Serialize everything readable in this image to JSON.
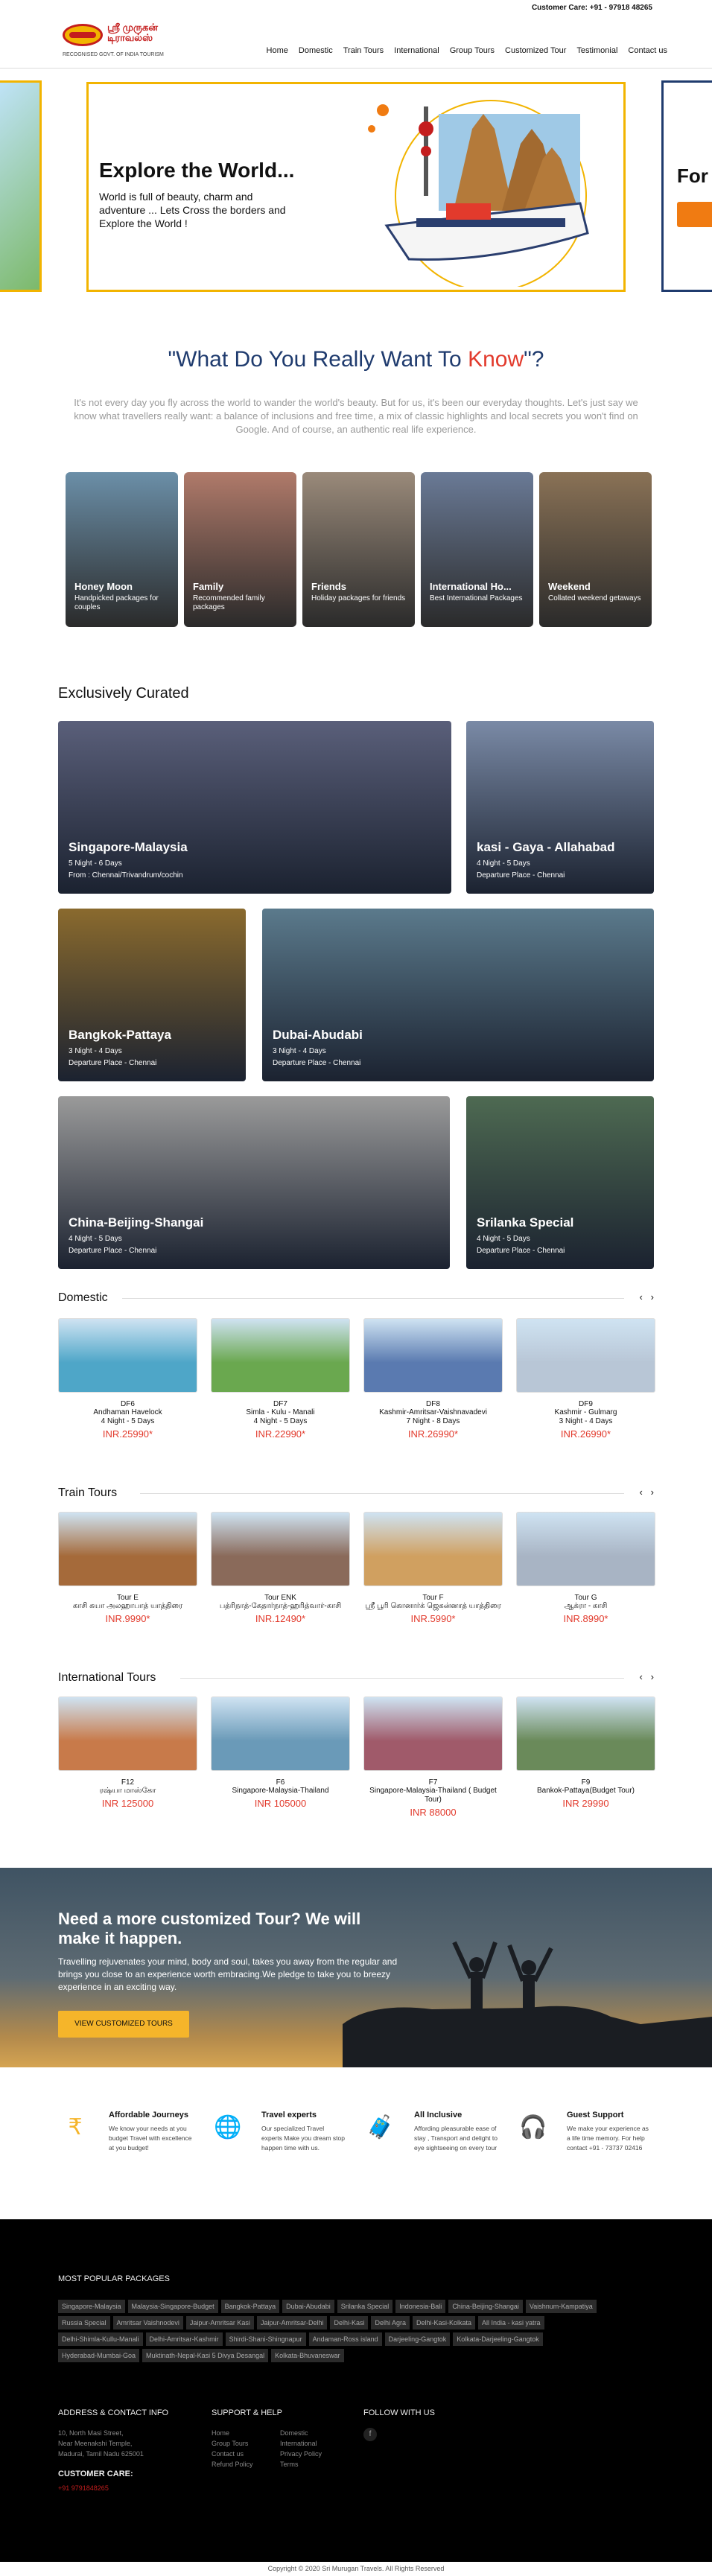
{
  "topbar": {
    "customer_care": "Customer Care: +91 - 97918 48265"
  },
  "logo": {
    "title": "ஸ்ரீ முருகன் டிராவல்ஸ்",
    "sub": "RECOGNISED GOVT. OF INDIA TOURISM"
  },
  "nav": [
    "Home",
    "Domestic",
    "Train Tours",
    "International",
    "Group Tours",
    "Customized Tour",
    "Testimonial",
    "Contact us"
  ],
  "hero": {
    "title": "Explore the World...",
    "text": "World is full of beauty, charm and adventure ... Lets Cross the borders and Explore the World !",
    "side_text": "For"
  },
  "section": {
    "title_a": "\"What Do You Really Want To ",
    "title_b": "Know",
    "title_c": "\"?",
    "intro": "It's not every day you fly across the world to wander the world's beauty. But for us, it's been our everyday thoughts. Let's just say we know what travellers really want: a balance of inclusions and free time, a mix of classic highlights and local secrets you won't find on Google. And of course, an authentic real life experience."
  },
  "categories": [
    {
      "title": "Honey Moon",
      "desc": "Handpicked packages for couples",
      "color": "#6b8fa8"
    },
    {
      "title": "Family",
      "desc": "Recommended family packages",
      "color": "#b07a6a"
    },
    {
      "title": "Friends",
      "desc": "Holiday packages for friends",
      "color": "#9a8a7a"
    },
    {
      "title": "International Ho...",
      "desc": "Best International Packages",
      "color": "#6a7a96"
    },
    {
      "title": "Weekend",
      "desc": "Collated weekend getaways",
      "color": "#8a7256"
    }
  ],
  "curated": {
    "heading": "Exclusively Curated",
    "tiles": [
      {
        "name": "Singapore-Malaysia",
        "a": "5 Night - 6 Days",
        "b": "From : Chennai/Trivandrum/cochin",
        "color": "#5a5f7a"
      },
      {
        "name": "kasi - Gaya - Allahabad",
        "a": "4 Night - 5 Days",
        "b": "Departure Place - Chennai",
        "color": "#7a8aa6"
      },
      {
        "name": "Bangkok-Pattaya",
        "a": "3 Night - 4 Days",
        "b": "Departure Place - Chennai",
        "color": "#8a6a2e"
      },
      {
        "name": "Dubai-Abudabi",
        "a": "3 Night - 4 Days",
        "b": "Departure Place - Chennai",
        "color": "#5b7a8c"
      },
      {
        "name": "China-Beijing-Shangai",
        "a": "4 Night - 5 Days",
        "b": "Departure Place - Chennai",
        "color": "#9a9a9a"
      },
      {
        "name": "Srilanka Special",
        "a": "4 Night - 5 Days",
        "b": "Departure Place - Chennai",
        "color": "#4e6a52"
      }
    ]
  },
  "domestic": {
    "heading": "Domestic",
    "cards": [
      {
        "code": "DF6",
        "name": "Andhaman Havelock",
        "dur": "4 Night - 5 Days",
        "price": "INR.25990*",
        "color": "#4ea6c8"
      },
      {
        "code": "DF7",
        "name": "Simla - Kulu - Manali",
        "dur": "4 Night - 5 Days",
        "price": "INR.22990*",
        "color": "#6aa84f"
      },
      {
        "code": "DF8",
        "name": "Kashmir-Amritsar-Vaishnavadevi",
        "dur": "7 Night - 8 Days",
        "price": "INR.26990*",
        "color": "#5a7ab0"
      },
      {
        "code": "DF9",
        "name": "Kashmir - Gulmarg",
        "dur": "3 Night - 4 Days",
        "price": "INR.26990*",
        "color": "#b8c6d6"
      }
    ]
  },
  "train": {
    "heading": "Train Tours",
    "cards": [
      {
        "code": "Tour E",
        "name": "காசி கயா அலஹாபாத் யாத்திரை",
        "price": "INR.9990*",
        "color": "#a56a3a"
      },
      {
        "code": "Tour ENK",
        "name": "பத்ரிநாத்-கேதார்நாத்-ஹரித்வார்-காசி",
        "price": "INR.12490*",
        "color": "#8a6a5a"
      },
      {
        "code": "Tour F",
        "name": "ஸ்ரீ பூரி கொனார்க் ஜெகன்னாத் யாத்திரை",
        "price": "INR.5990*",
        "color": "#d0a060"
      },
      {
        "code": "Tour G",
        "name": "ஆக்ரா - காசி",
        "price": "INR.8990*",
        "color": "#a8b4c4"
      }
    ]
  },
  "international": {
    "heading": "International Tours",
    "cards": [
      {
        "code": "F12",
        "name": "ரஷ்யா மாஸ்கோ",
        "price": "INR 125000",
        "color": "#c87a4a"
      },
      {
        "code": "F6",
        "name": "Singapore-Malaysia-Thailand",
        "price": "INR 105000",
        "color": "#6a9ab8"
      },
      {
        "code": "F7",
        "name": "Singapore-Malaysia-Thailand ( Budget Tour)",
        "price": "INR 88000",
        "color": "#a05a6a"
      },
      {
        "code": "F9",
        "name": "Bankok-Pattaya(Budget Tour)",
        "price": "INR 29990",
        "color": "#6a8a5a"
      }
    ]
  },
  "cta": {
    "title": "Need a more customized Tour? We will make it happen.",
    "text": "Travelling rejuvenates your mind, body and soul, takes you away from the regular and brings you close to an experience worth embracing.We pledge to take you to breezy experience in an exciting way.",
    "button": "VIEW CUSTOMIZED TOURS"
  },
  "features": [
    {
      "icon": "rupee-icon",
      "glyph": "₹",
      "title": "Affordable Journeys",
      "desc": "We know your needs at you budget Travel with excellence at you budget!"
    },
    {
      "icon": "globe-icon",
      "glyph": "🌐",
      "title": "Travel experts",
      "desc": "Our specialized Travel experts Make you dream stop happen time with us."
    },
    {
      "icon": "suitcase-icon",
      "glyph": "🧳",
      "title": "All Inclusive",
      "desc": "Affording pleasurable ease of stay , Transport and delight to eye sightseeing on every tour"
    },
    {
      "icon": "headset-icon",
      "glyph": "🎧",
      "title": "Guest Support",
      "desc": "We make your experience as a life time memory. For help contact +91 - 73737 02416"
    }
  ],
  "footer": {
    "popular_heading": "MOST POPULAR PACKAGES",
    "packages": [
      "Singapore-Malaysia",
      "Malaysia-Singapore-Budget",
      "Bangkok-Pattaya",
      "Dubai-Abudabi",
      "Srilanka Special",
      "Indonesia-Bali",
      "China-Beijing-Shangai",
      "Vaishnum-Kampatiya",
      "Russia Special",
      "Amritsar Vaishnodevi",
      "Jaipur-Amritsar Kasi",
      "Jaipur-Amritsar-Delhi",
      "Delhi-Kasi",
      "Delhi Agra",
      "Delhi-Kasi-Kolkata",
      "All India - kasi yatra",
      "Delhi-Shimla-Kullu-Manali",
      "Delhi-Amritsar-Kashmir",
      "Shirdi-Shani-Shingnapur",
      "Andaman-Ross island",
      "Darjeeling-Gangtok",
      "Kolkata-Darjeeling-Gangtok",
      "Hyderabad-Mumbai-Goa",
      "Muktinath-Nepal-Kasi 5 Divya Desangal",
      "Kolkata-Bhuvaneswar"
    ],
    "address_heading": "ADDRESS & CONTACT INFO",
    "address": [
      "10, North Masi Street,",
      "Near Meenakshi Temple,",
      "Madurai, Tamil Nadu 625001"
    ],
    "customer_care_heading": "CUSTOMER CARE:",
    "customer_care": "+91 9791848265",
    "support_heading": "SUPPORT & HELP",
    "support_col1": [
      "Home",
      "Group Tours",
      "Contact us",
      "Refund Policy"
    ],
    "support_col2": [
      "Domestic",
      "International",
      "Privacy Policy",
      "Terms"
    ],
    "follow_heading": "FOLLOW WITH US",
    "copyright": "Copyright © 2020 Sri Murugan Travels. All Rights Reserved"
  }
}
